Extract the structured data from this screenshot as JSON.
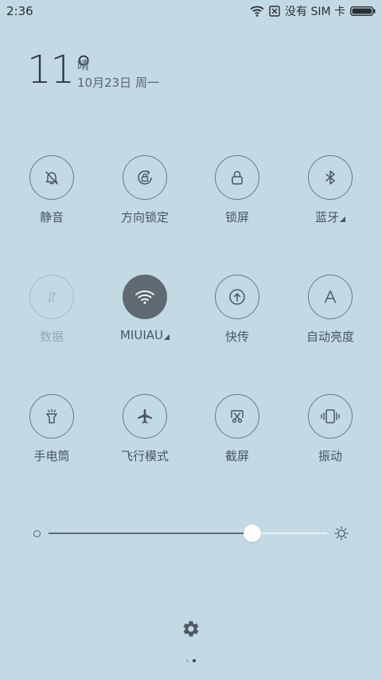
{
  "status_bar": {
    "time": "2:36",
    "sim_status": "没有 SIM 卡",
    "icons": [
      "wifi-icon",
      "no-sim-icon",
      "battery-icon"
    ]
  },
  "weather": {
    "temperature": "11°",
    "condition": "晴",
    "date": "10月23日 周一"
  },
  "toggles": [
    {
      "label": "静音",
      "icon": "bell-off-icon",
      "state": "off"
    },
    {
      "label": "方向锁定",
      "icon": "rotation-lock-icon",
      "state": "off"
    },
    {
      "label": "锁屏",
      "icon": "lock-icon",
      "state": "off"
    },
    {
      "label": "蓝牙",
      "icon": "bluetooth-icon",
      "state": "off",
      "has_more": true
    },
    {
      "label": "数据",
      "icon": "data-arrows-icon",
      "state": "disabled"
    },
    {
      "label": "MIUIAU",
      "icon": "wifi-icon",
      "state": "on",
      "has_more": true
    },
    {
      "label": "快传",
      "icon": "upload-icon",
      "state": "off"
    },
    {
      "label": "自动亮度",
      "icon": "auto-brightness-icon",
      "state": "off"
    },
    {
      "label": "手电筒",
      "icon": "flashlight-icon",
      "state": "off"
    },
    {
      "label": "飞行模式",
      "icon": "airplane-icon",
      "state": "off"
    },
    {
      "label": "截屏",
      "icon": "screenshot-icon",
      "state": "off"
    },
    {
      "label": "振动",
      "icon": "vibrate-icon",
      "state": "off"
    }
  ],
  "brightness": {
    "level": 0.73,
    "icons": [
      "brightness-low-icon",
      "brightness-high-icon"
    ]
  },
  "footer": {
    "settings_icon": "gear-icon",
    "pages": 2,
    "current_page": 2
  },
  "colors": {
    "background": "#c3dae5",
    "active_toggle": "#5f6a73",
    "text": "#4a5560"
  }
}
